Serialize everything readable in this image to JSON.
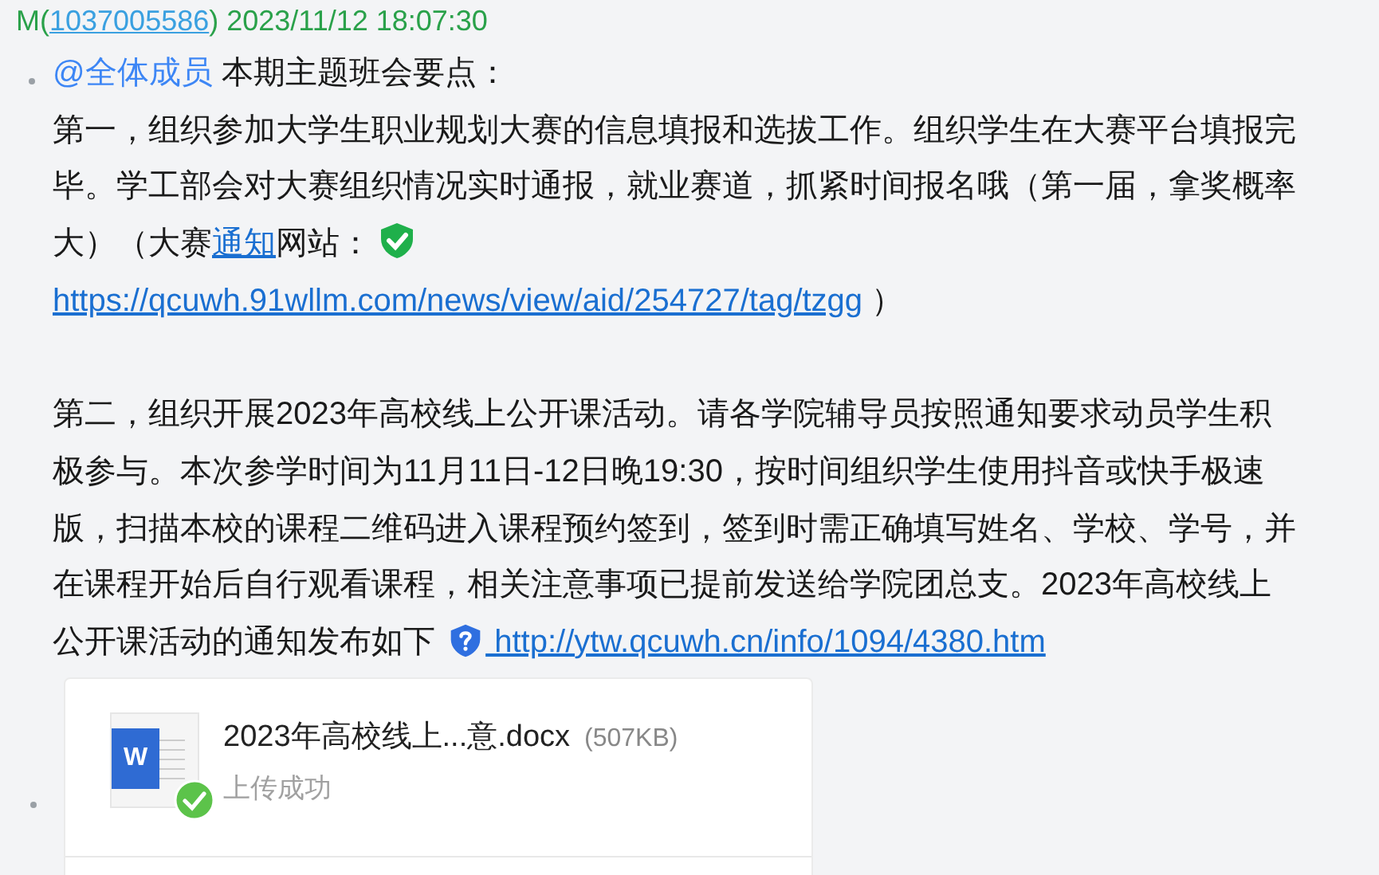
{
  "message": {
    "header": [
      {
        "kind": "text",
        "text": "M("
      },
      {
        "kind": "link",
        "text": "1037005586"
      },
      {
        "kind": "text",
        "text": ")"
      },
      {
        "kind": "time",
        "text": " 2023/11/12 18:07:30"
      }
    ],
    "paragraphs": [
      [
        [
          {
            "kind": "mention",
            "text": "@全体成员"
          },
          {
            "kind": "text",
            "text": " 本期主题班会要点："
          }
        ],
        [
          {
            "kind": "text",
            "text": "第一，组织参加大学生职业规划大赛的信息填报和选拔工作。组织学生在大赛平台填报完"
          }
        ],
        [
          {
            "kind": "text",
            "text": "毕。学工部会对大赛组织情况实时通报，就业赛道，抓紧时间报名哦（第一届，拿奖概率"
          }
        ],
        [
          {
            "kind": "text",
            "text": "大）（大赛"
          },
          {
            "kind": "link",
            "text": "通知"
          },
          {
            "kind": "text",
            "text": "网站："
          },
          {
            "kind": "shield",
            "safe": true
          }
        ],
        [
          {
            "kind": "link",
            "text": "https://qcuwh.91wllm.com/news/view/aid/254727/tag/tzgg"
          },
          {
            "kind": "text",
            "text": " ）"
          }
        ]
      ],
      [
        [
          {
            "kind": "text",
            "text": "第二，组织开展2023年高校线上公开课活动。请各学院辅导员按照通知要求动员学生积"
          }
        ],
        [
          {
            "kind": "text",
            "text": "极参与。本次参学时间为11月11日-12日晚19:30，按时间组织学生使用抖音或快手极速"
          }
        ],
        [
          {
            "kind": "text",
            "text": "版，扫描本校的课程二维码进入课程预约签到，签到时需正确填写姓名、学校、学号，并"
          }
        ],
        [
          {
            "kind": "text",
            "text": "在课程开始后自行观看课程，相关注意事项已提前发送给学院团总支。2023年高校线上"
          }
        ],
        [
          {
            "kind": "text",
            "text": "公开课活动的通知发布如下 "
          },
          {
            "kind": "shield",
            "safe": false
          },
          {
            "kind": "link",
            "text": " http://ytw.qcuwh.cn/info/1094/4380.htm"
          }
        ]
      ]
    ]
  },
  "file": {
    "icon_letter": "W",
    "name": "2023年高校线上...意.docx",
    "size": "(507KB)",
    "status": "上传成功",
    "uploaded": true
  }
}
